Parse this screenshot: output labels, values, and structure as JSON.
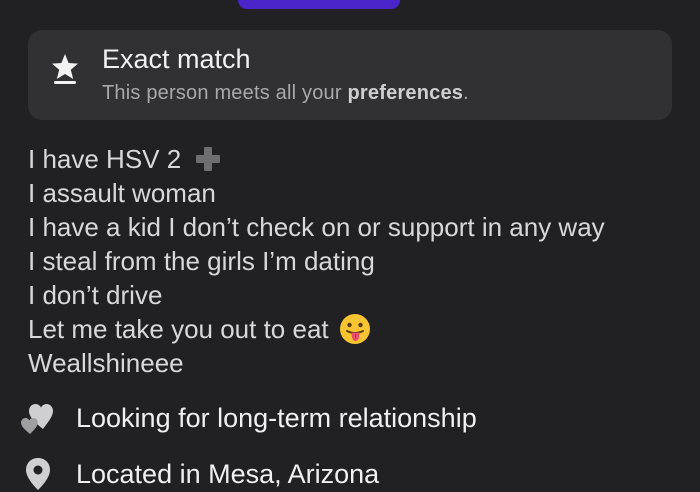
{
  "match": {
    "icon": "star-badge-icon",
    "title": "Exact match",
    "subtitle_prefix": "This person meets all your ",
    "subtitle_bold": "preferences",
    "subtitle_suffix": "."
  },
  "bio": {
    "lines": [
      "I have HSV 2",
      "I assault woman",
      "I have a kid I don’t check on or support in any way",
      "I steal from the girls I’m dating",
      "I don’t drive",
      "Let me take you out to eat",
      "Weallshineee"
    ],
    "inline_icons": {
      "line_0": "plus-icon",
      "line_5": "tongue-out-emoji-icon"
    }
  },
  "info": [
    {
      "icon": "hearts-icon",
      "label": "Looking for long-term relationship"
    },
    {
      "icon": "location-pin-icon",
      "label": "Located in Mesa, Arizona"
    }
  ],
  "colors": {
    "background": "#212124",
    "card": "#313134",
    "accent_button": "#4a25c9"
  }
}
